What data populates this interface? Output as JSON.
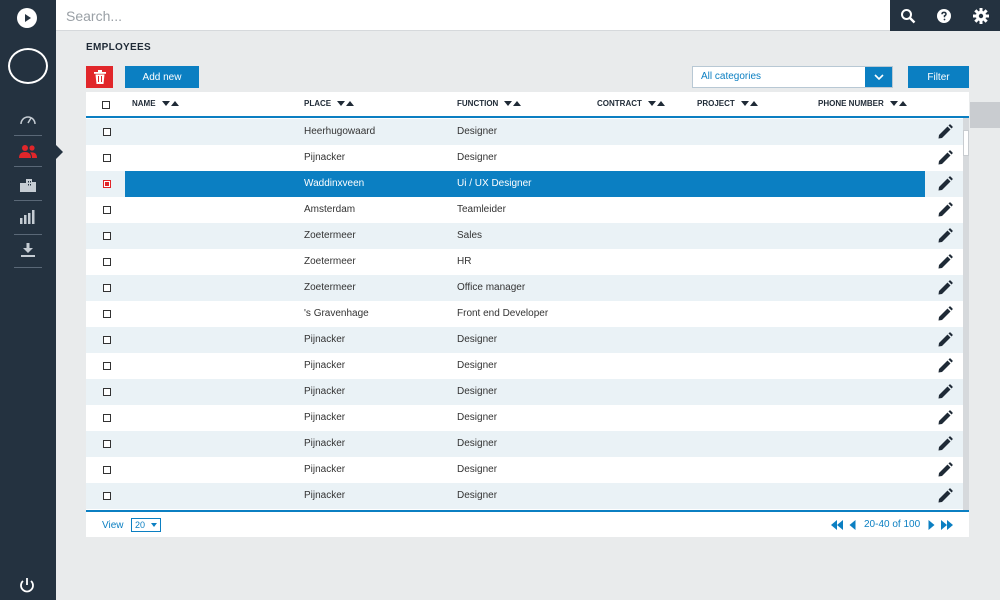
{
  "search": {
    "placeholder": "Search..."
  },
  "page": {
    "title": "EMPLOYEES"
  },
  "toolbar": {
    "add_label": "Add new",
    "category_value": "All categories",
    "filter_label": "Filter"
  },
  "table": {
    "columns": [
      "NAME",
      "PLACE",
      "FUNCTION",
      "CONTRACT",
      "PROJECT",
      "PHONE NUMBER"
    ],
    "rows": [
      {
        "place": "Heerhugowaard",
        "function": "Designer"
      },
      {
        "place": "Pijnacker",
        "function": "Designer"
      },
      {
        "place": "Waddinxveen",
        "function": "Ui / UX Designer"
      },
      {
        "place": "Amsterdam",
        "function": "Teamleider"
      },
      {
        "place": "Zoetermeer",
        "function": "Sales"
      },
      {
        "place": "Zoetermeer",
        "function": "HR"
      },
      {
        "place": "Zoetermeer",
        "function": "Office manager"
      },
      {
        "place": "'s Gravenhage",
        "function": "Front end Developer"
      },
      {
        "place": "Pijnacker",
        "function": "Designer"
      },
      {
        "place": "Pijnacker",
        "function": "Designer"
      },
      {
        "place": "Pijnacker",
        "function": "Designer"
      },
      {
        "place": "Pijnacker",
        "function": "Designer"
      },
      {
        "place": "Pijnacker",
        "function": "Designer"
      },
      {
        "place": "Pijnacker",
        "function": "Designer"
      },
      {
        "place": "Pijnacker",
        "function": "Designer"
      }
    ],
    "selected_row": 2
  },
  "footer": {
    "view_label": "View",
    "view_value": "20",
    "range": "20-40 of 100"
  },
  "colors": {
    "sidebar": "#243240",
    "accent": "#0b7fc2",
    "danger": "#e1262a",
    "alt_row": "#eaf2f6"
  },
  "icons": {
    "sidebar": [
      "speedometer-icon",
      "users-icon",
      "buildings-icon",
      "bar-chart-icon",
      "download-icon"
    ],
    "topbar": [
      "search-icon",
      "help-icon",
      "gear-icon"
    ]
  }
}
